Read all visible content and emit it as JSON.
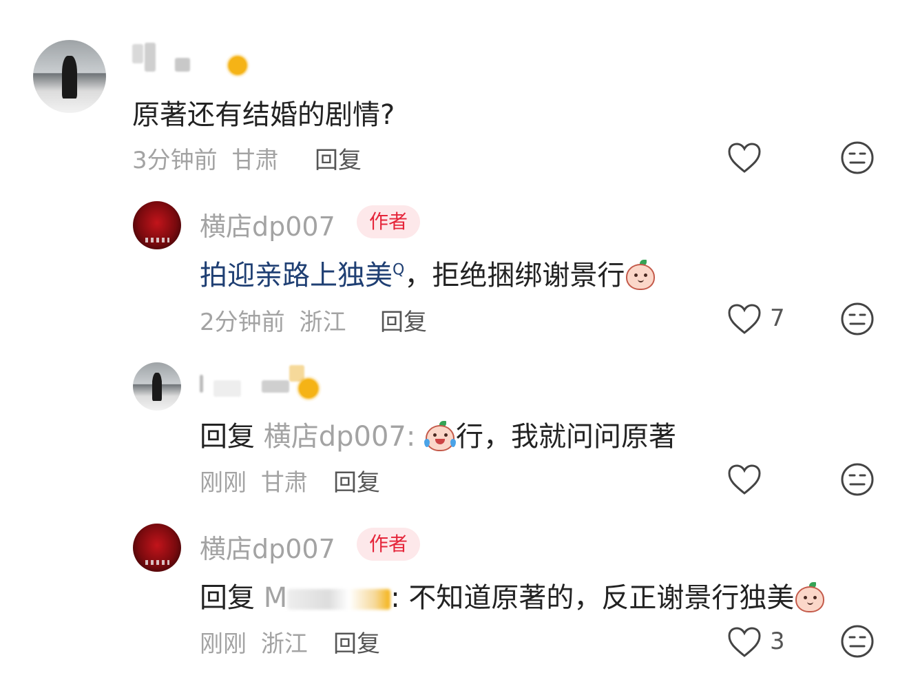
{
  "comments": [
    {
      "text": "原著还有结婚的剧情?",
      "time": "3分钟前",
      "location": "甘肃",
      "reply_label": "回复",
      "likes": ""
    },
    {
      "username": "横店dp007",
      "author_tag": "作者",
      "text_link": "拍迎亲路上独美",
      "text_rest": "，拒绝捆绑谢景行",
      "time": "2分钟前",
      "location": "浙江",
      "reply_label": "回复",
      "likes": "7"
    },
    {
      "reply_prefix": "回复",
      "reply_target": "横店dp007:",
      "text": "行，我就问问原著",
      "time": "刚刚",
      "location": "甘肃",
      "reply_label": "回复",
      "likes": ""
    },
    {
      "username": "横店dp007",
      "author_tag": "作者",
      "reply_prefix": "回复",
      "reply_target": "M",
      "text": ": 不知道原著的，反正谢景行独美",
      "time": "刚刚",
      "location": "浙江",
      "reply_label": "回复",
      "likes": "3"
    }
  ],
  "colors": {
    "author_tag_bg": "#fde8ea",
    "author_tag_text": "#e5253a",
    "link": "#1f3f73",
    "meta": "#a3a3a3"
  },
  "icons": [
    "heart-icon",
    "neutral-face-icon",
    "smile-emoji",
    "cry-laugh-emoji",
    "search-icon"
  ]
}
